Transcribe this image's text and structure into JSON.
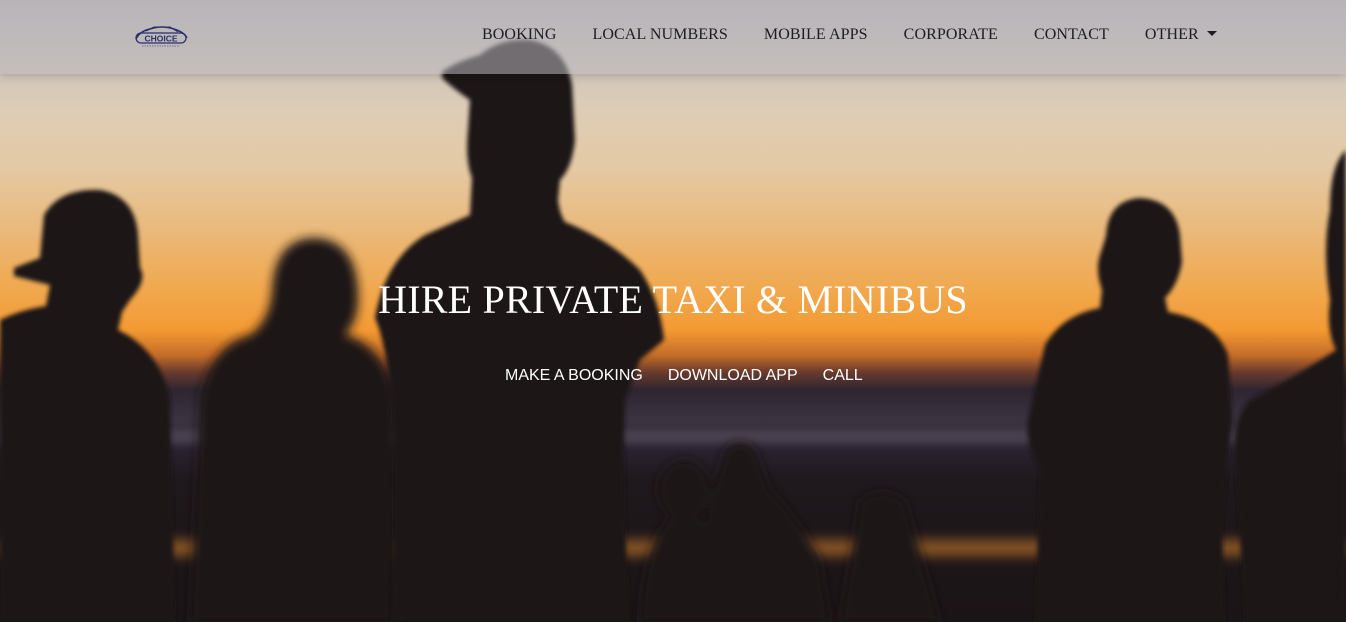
{
  "brand": {
    "logo_text": "CHOICE"
  },
  "nav": {
    "items": [
      {
        "label": "BOOKING"
      },
      {
        "label": "LOCAL NUMBERS"
      },
      {
        "label": "MOBILE APPS"
      },
      {
        "label": "CORPORATE"
      },
      {
        "label": "CONTACT"
      },
      {
        "label": "OTHER"
      }
    ]
  },
  "hero": {
    "title": "HIRE PRIVATE TAXI & MINIBUS",
    "actions": [
      {
        "label": "MAKE A BOOKING"
      },
      {
        "label": "DOWNLOAD APP"
      },
      {
        "label": "CALL"
      }
    ]
  },
  "colors": {
    "sky_top": "#b6b2b6",
    "sunset_orange": "#f39a33",
    "silhouette": "#1b1416",
    "nav_text": "#1c1c24",
    "hero_text": "#ffffff"
  }
}
